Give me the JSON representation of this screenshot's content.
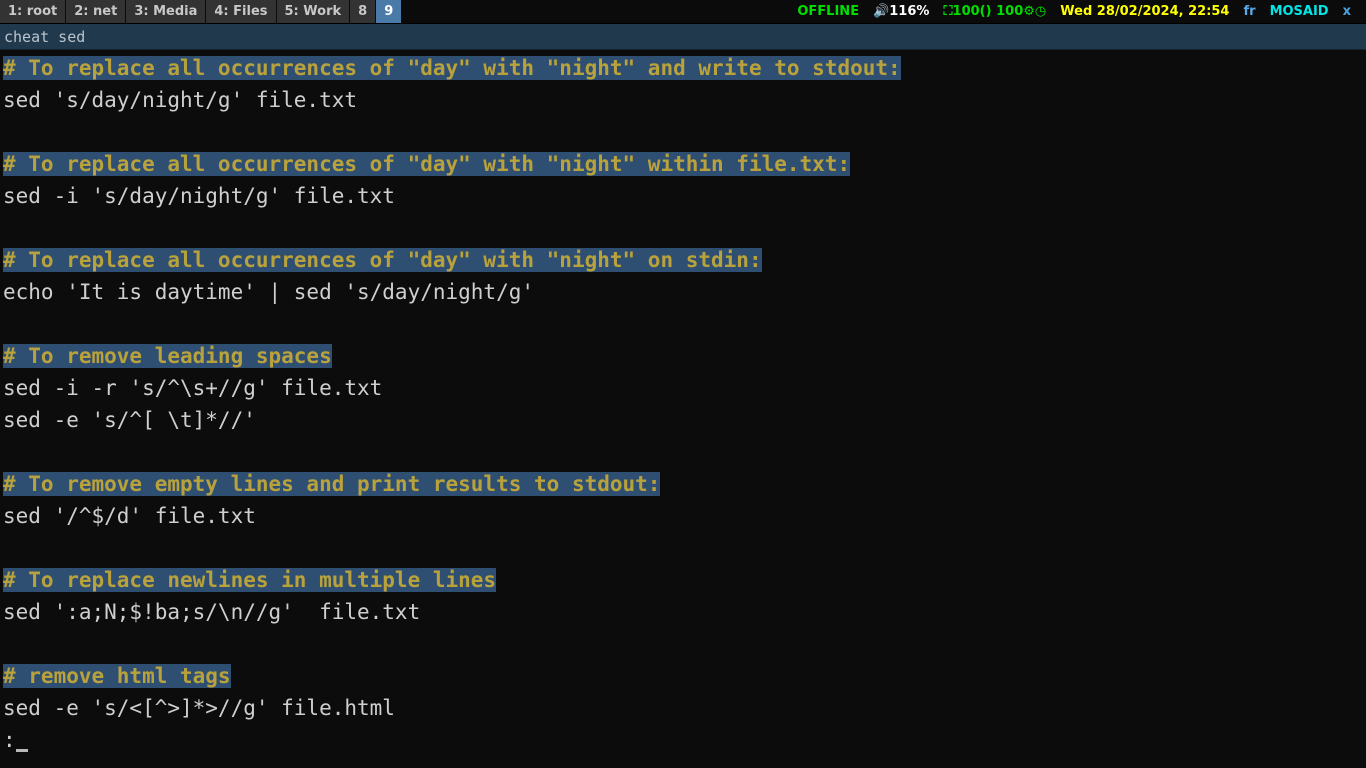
{
  "statusbar": {
    "workspaces": [
      {
        "label": "1: root",
        "active": false
      },
      {
        "label": "2: net",
        "active": false
      },
      {
        "label": "3: Media",
        "active": false
      },
      {
        "label": "4: Files",
        "active": false
      },
      {
        "label": "5: Work",
        "active": false
      },
      {
        "label": "8",
        "active": false
      },
      {
        "label": "9",
        "active": true
      }
    ],
    "network_status": "OFFLINE",
    "volume_icon": "speaker-icon",
    "volume": "116%",
    "battery_icon": "battery-full-icon",
    "battery": "100()",
    "cpu": "100",
    "gear_icon": "gear-icon",
    "clock_icon": "clock-icon",
    "datetime": "Wed 28/02/2024, 22:54",
    "keyboard_layout": "fr",
    "hostname": "MOSAID",
    "close_label": "x",
    "colors": {
      "offline": "#00e000",
      "volume": "#ffffff",
      "battery": "#00e000",
      "datetime": "#ffff00",
      "hostname": "#00e5e5",
      "layout": "#5aa9e6",
      "close": "#4aa3df",
      "active_ws_bg": "#4a7aa8",
      "ws_bg": "#333333"
    }
  },
  "cmdbar": {
    "command": "cheat sed"
  },
  "terminal": {
    "colors": {
      "background": "#0c0c0c",
      "comment_bg": "#2f4f72",
      "comment_fg": "#b9a23c",
      "code_fg": "#cfcfcf"
    },
    "lines": [
      {
        "type": "comment",
        "text": "# To replace all occurrences of \"day\" with \"night\" and write to stdout:"
      },
      {
        "type": "code",
        "text": "sed 's/day/night/g' file.txt"
      },
      {
        "type": "blank",
        "text": ""
      },
      {
        "type": "comment",
        "text": "# To replace all occurrences of \"day\" with \"night\" within file.txt:"
      },
      {
        "type": "code",
        "text": "sed -i 's/day/night/g' file.txt"
      },
      {
        "type": "blank",
        "text": ""
      },
      {
        "type": "comment",
        "text": "# To replace all occurrences of \"day\" with \"night\" on stdin:"
      },
      {
        "type": "code",
        "text": "echo 'It is daytime' | sed 's/day/night/g'"
      },
      {
        "type": "blank",
        "text": ""
      },
      {
        "type": "comment",
        "text": "# To remove leading spaces"
      },
      {
        "type": "code",
        "text": "sed -i -r 's/^\\s+//g' file.txt"
      },
      {
        "type": "code",
        "text": "sed -e 's/^[ \\t]*//'"
      },
      {
        "type": "blank",
        "text": ""
      },
      {
        "type": "comment",
        "text": "# To remove empty lines and print results to stdout:"
      },
      {
        "type": "code",
        "text": "sed '/^$/d' file.txt"
      },
      {
        "type": "blank",
        "text": ""
      },
      {
        "type": "comment",
        "text": "# To replace newlines in multiple lines"
      },
      {
        "type": "code",
        "text": "sed ':a;N;$!ba;s/\\n//g'  file.txt"
      },
      {
        "type": "blank",
        "text": ""
      },
      {
        "type": "comment",
        "text": "# remove html tags"
      },
      {
        "type": "code",
        "text": "sed -e 's/<[^>]*>//g' file.html"
      },
      {
        "type": "prompt",
        "text": ":"
      }
    ]
  }
}
